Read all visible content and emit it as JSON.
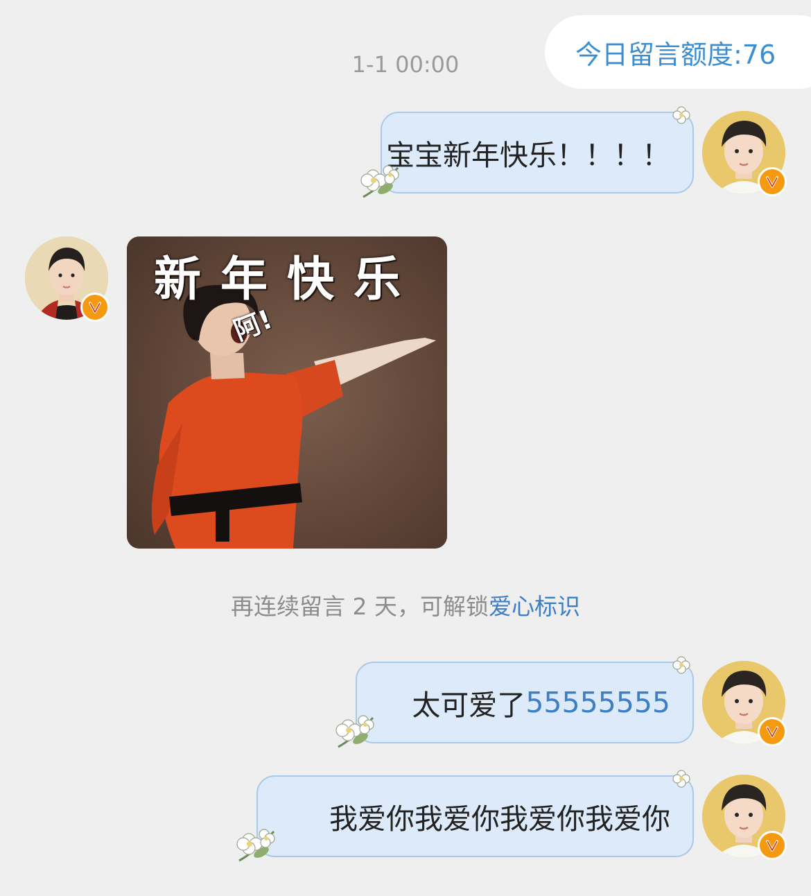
{
  "header": {
    "quota_label": "今日留言额度:76"
  },
  "chat": {
    "timestamp": "1-1 00:00",
    "messages": [
      {
        "sender": "me",
        "type": "text",
        "text": "宝宝新年快乐！！！！"
      },
      {
        "sender": "other",
        "type": "sticker",
        "sticker_title": "新年快乐",
        "sticker_shout": "阿!"
      },
      {
        "sender": "me",
        "type": "text",
        "text": "太可爱了 ",
        "highlight": "55555555"
      },
      {
        "sender": "me",
        "type": "text",
        "text": "我爱你我爱你我爱你我爱你"
      }
    ],
    "system_notice": {
      "prefix": "再连续留言 2 天，可解锁",
      "link": "爱心标识"
    }
  },
  "badge_letter": "V",
  "colors": {
    "background": "#efefef",
    "bubble_fill": "#dceafa",
    "bubble_border": "#a9c9e8",
    "accent_blue": "#3d8ed1",
    "verified_badge": "#f59a10"
  }
}
